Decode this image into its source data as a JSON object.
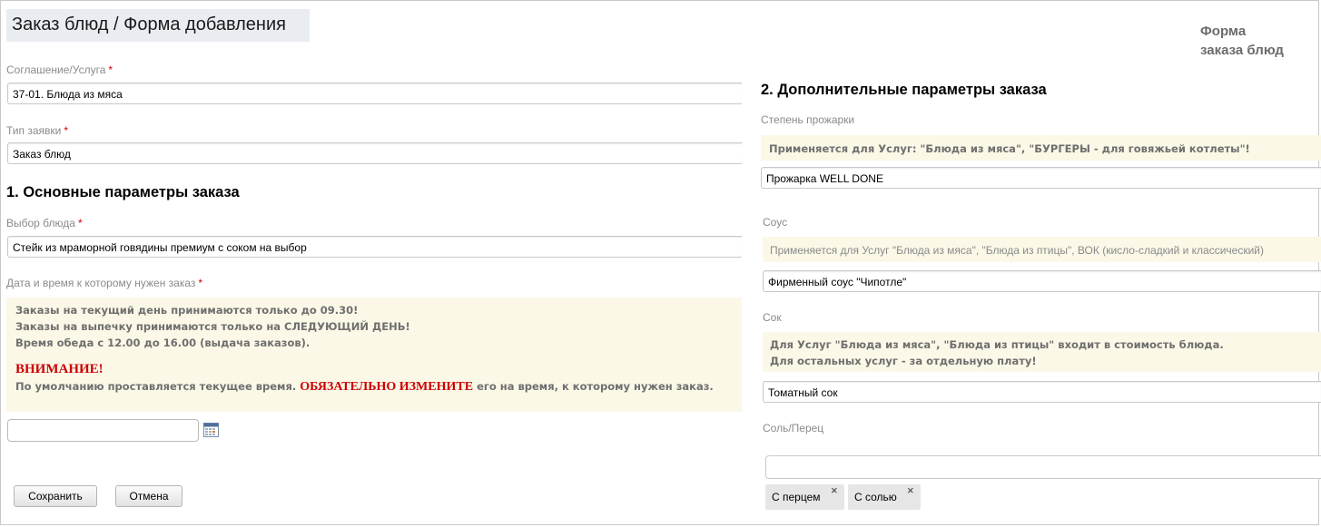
{
  "page": {
    "title": "Заказ блюд / Форма добавления",
    "corner_title_line1": "Форма",
    "corner_title_line2": "заказа блюд"
  },
  "left": {
    "agreement": {
      "label": "Соглашение/Услуга",
      "required_mark": "*",
      "value": "37-01. Блюда из мяса"
    },
    "request_type": {
      "label": "Тип заявки",
      "required_mark": "*",
      "value": "Заказ блюд"
    },
    "section1_title": "1. Основные параметры заказа",
    "dish": {
      "label": "Выбор блюда",
      "required_mark": "*",
      "value": "Стейк из мраморной говядины премиум с соком на выбор"
    },
    "datetime": {
      "label": "Дата и время к которому нужен заказ",
      "required_mark": "*",
      "note_line1": "Заказы на текущий день принимаются только до 09.30!",
      "note_line2": "Заказы на выпечку принимаются только на СЛЕДУЮЩИЙ ДЕНЬ!",
      "note_line3": "Время обеда с 12.00 до 16.00 (выдача заказов).",
      "warning_title": "ВНИМАНИЕ!",
      "warning_prefix": "По умолчанию проставляется текущее время.",
      "warning_emphasis": "ОБЯЗАТЕЛЬНО ИЗМЕНИТЕ",
      "warning_suffix": "его на время, к которому нужен заказ.",
      "value": ""
    },
    "buttons": {
      "save": "Сохранить",
      "cancel": "Отмена"
    }
  },
  "right": {
    "section2_title": "2. Дополнительные параметры заказа",
    "doneness": {
      "label": "Степень прожарки",
      "note": "Применяется для Услуг:  \"Блюда из мяса\",  \"БУРГЕРЫ - для говяжьей котлеты\"!",
      "value": "Прожарка WELL DONE"
    },
    "sauce": {
      "label": "Соус",
      "note": "Применяется для Услуг \"Блюда из мяса\", \"Блюда из птицы\", ВОК (кисло-сладкий и классический)",
      "value": "Фирменный соус \"Чипотле\""
    },
    "juice": {
      "label": "Сок",
      "note_line1": "Для Услуг \"Блюда из мяса\", \"Блюда из птицы\" входит в стоимость блюда.",
      "note_line2": "Для остальных услуг - за отдельную плату!",
      "value": "Томатный сок"
    },
    "salt_pepper": {
      "label": "Соль/Перец",
      "tags": [
        "С перцем",
        "С солью"
      ],
      "remove_glyph": "×"
    }
  },
  "icons": {
    "calendar": "calendar-icon",
    "remove": "close-icon"
  },
  "colors": {
    "required": "#d40000",
    "warning": "#cc0000",
    "note_bg": "#fbf8e7",
    "title_bg": "#e9edf2"
  }
}
